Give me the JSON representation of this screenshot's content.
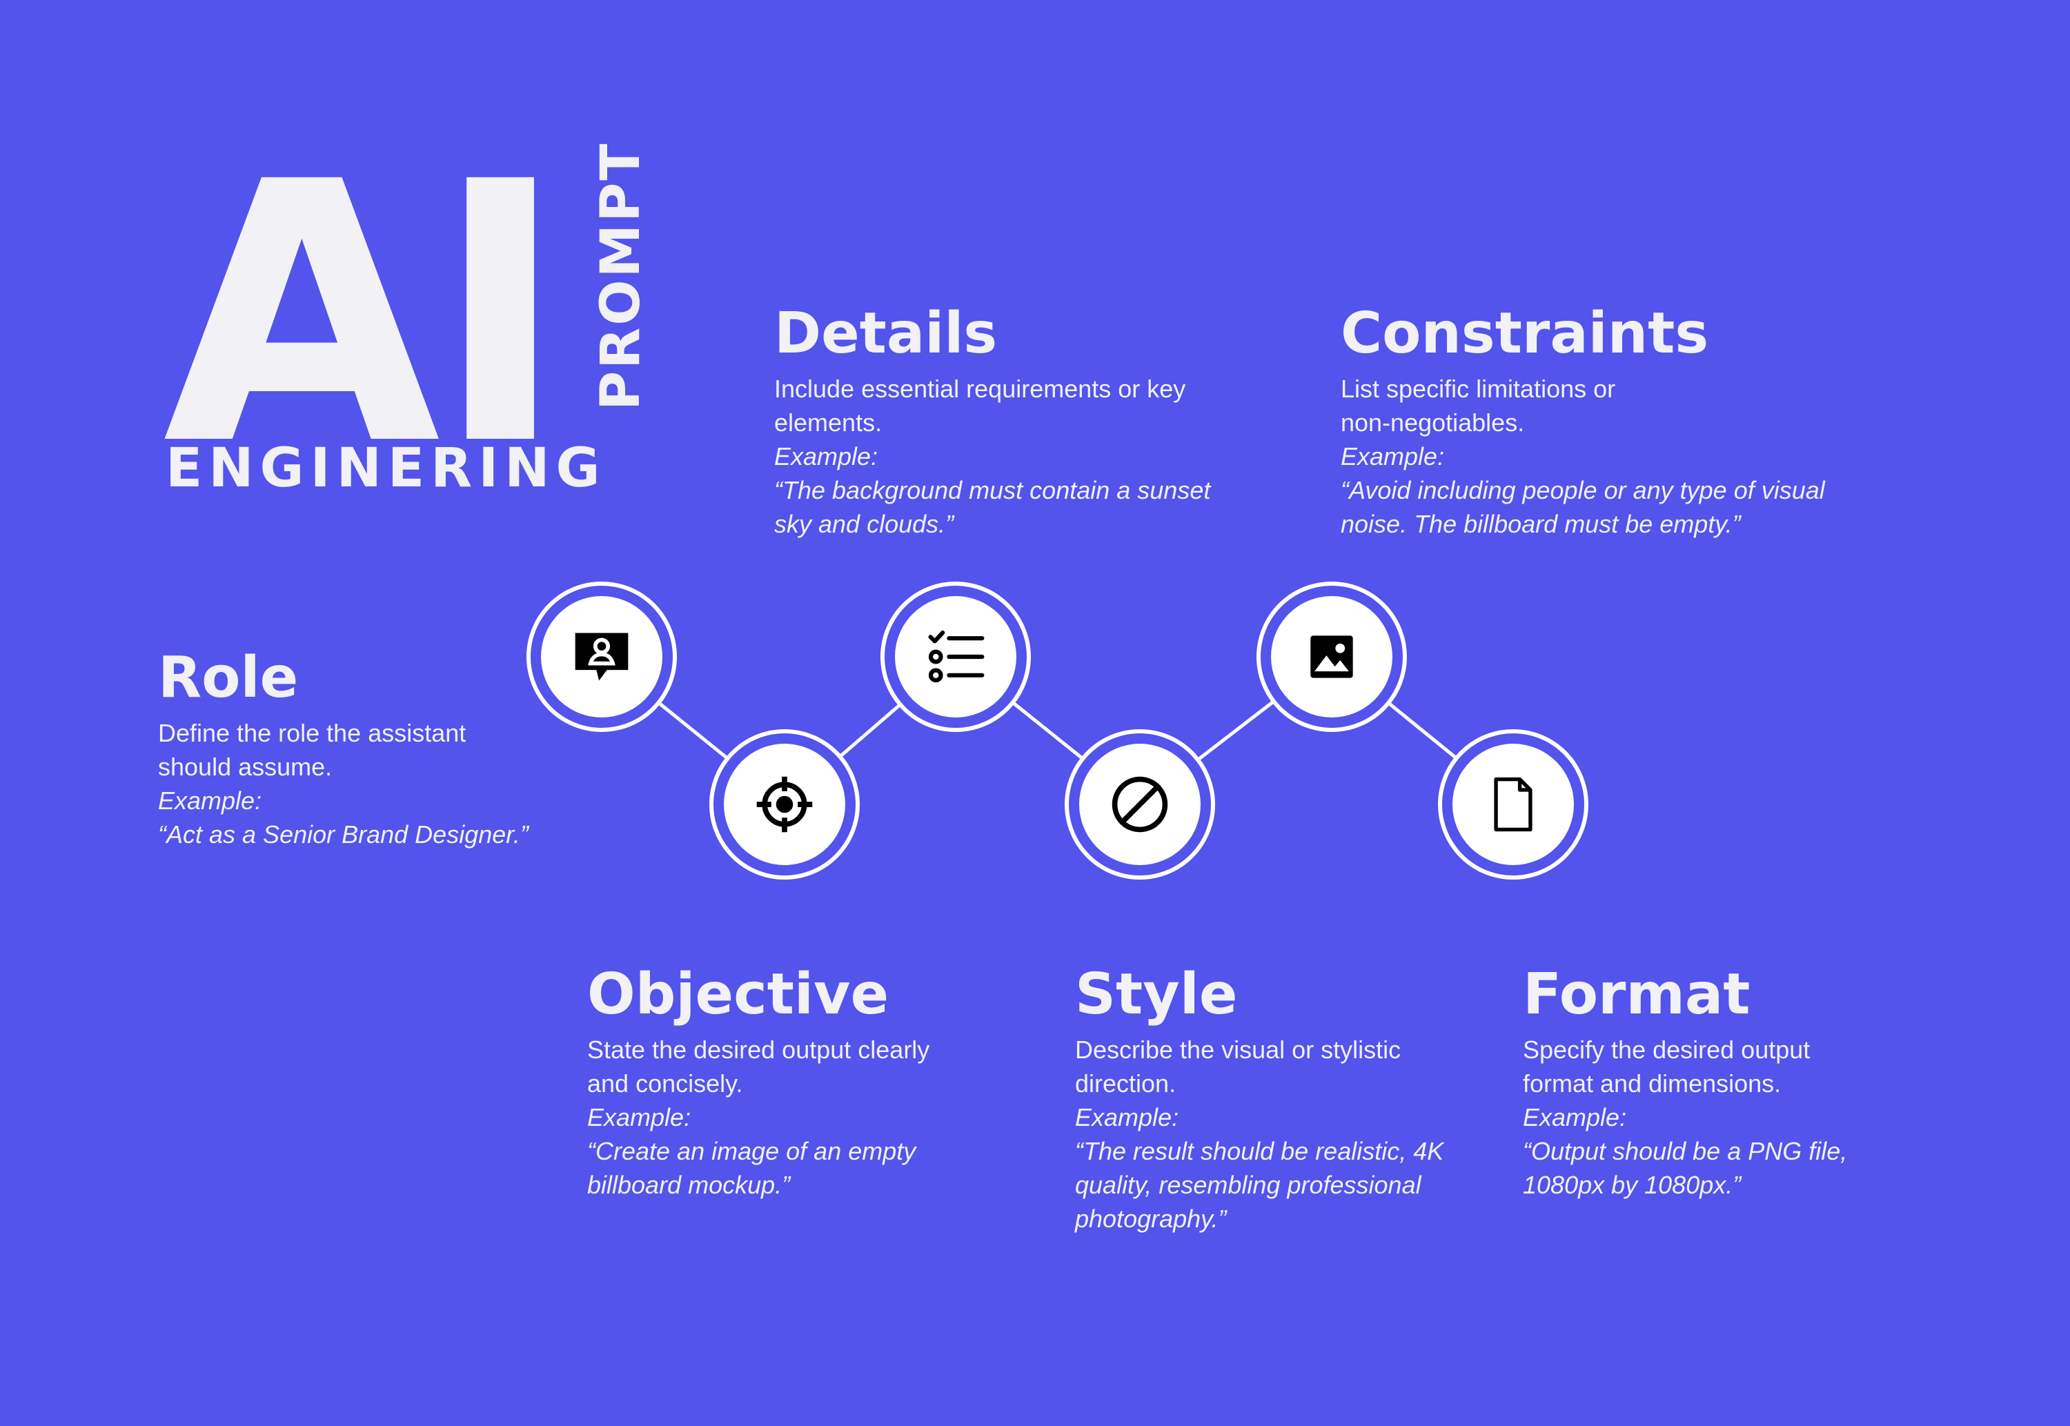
{
  "logo": {
    "ai": "AI",
    "prompt": "PROMPT",
    "engineering": "ENGINERING"
  },
  "cards": {
    "role": {
      "title": "Role",
      "description": "Define the role the assistant should assume.",
      "example_label": "Example:",
      "example": "“Act as a Senior Brand Designer.”",
      "icon": "user-chat-icon"
    },
    "objective": {
      "title": "Objective",
      "description": "State the desired output clearly and concisely.",
      "example_label": "Example:",
      "example": "“Create an image of an empty billboard mockup.”",
      "icon": "target-icon"
    },
    "details": {
      "title": "Details",
      "description": "Include essential requirements or key elements.",
      "example_label": "Example:",
      "example": "“The background must contain a sunset sky and clouds.”",
      "icon": "checklist-icon"
    },
    "style": {
      "title": "Style",
      "description": "Describe the visual or stylistic direction.",
      "example_label": "Example:",
      "example": "“The result should be realistic, 4K quality, resembling professional photography.”",
      "icon": "prohibited-icon"
    },
    "constraints": {
      "title": "Constraints",
      "description": "List specific limitations or non-negotiables.",
      "example_label": "Example:",
      "example": "“Avoid including people or any type of visual noise. The billboard must be empty.”",
      "icon": "image-icon"
    },
    "format": {
      "title": "Format",
      "description": "Specify the desired output format and dimensions.",
      "example_label": "Example:",
      "example": "“Output should be a PNG file, 1080px by 1080px.”",
      "icon": "document-icon"
    }
  },
  "colors": {
    "background": "#5354EB",
    "text": "#F1F1F6",
    "node_fill": "#FFFFFF",
    "icon": "#000000"
  }
}
